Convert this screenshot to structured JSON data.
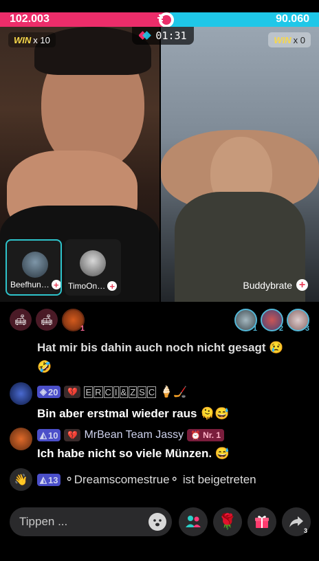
{
  "battle": {
    "left_score": "102.003",
    "right_score": "90.060",
    "timer": "01:31",
    "left_win_label": "WIN",
    "left_win_count": "x 10",
    "right_win_label": "WIN",
    "right_win_count": "x 0",
    "left_share": 0.533
  },
  "guests": [
    {
      "name": "Beefhun…",
      "active": true
    },
    {
      "name": "TimoOn…",
      "active": false
    }
  ],
  "opponent": {
    "name": "Buddybrate"
  },
  "top_viewers": [
    {
      "rank": "1"
    },
    {
      "rank": "2"
    },
    {
      "rank": "3"
    }
  ],
  "own_rank": "1",
  "chat": [
    {
      "type": "text-only",
      "text": "Hat mir bis dahin auch noch nicht gesagt 😢",
      "text2": "🤣"
    },
    {
      "type": "full",
      "level": "20",
      "user_chars": [
        "E",
        "R",
        "C",
        "I",
        "&",
        "Z",
        "S",
        "C"
      ],
      "trail": "🍦🏒",
      "text": "Bin aber erstmal wieder raus 🫠😅"
    },
    {
      "type": "full",
      "level": "10",
      "user": "MrBean Team Jassy",
      "nr_label": "Nr. 1",
      "text": "Ich habe nicht so viele Münzen. 😅"
    },
    {
      "type": "join",
      "level": "13",
      "user": "Dreamscomestrue",
      "text": "ist beigetreten"
    }
  ],
  "input": {
    "placeholder": "Tippen ..."
  },
  "share_count": "3",
  "colors": {
    "left": "#ec2d6a",
    "right": "#1fc7e8",
    "level_badge": "#4b4fc9"
  }
}
